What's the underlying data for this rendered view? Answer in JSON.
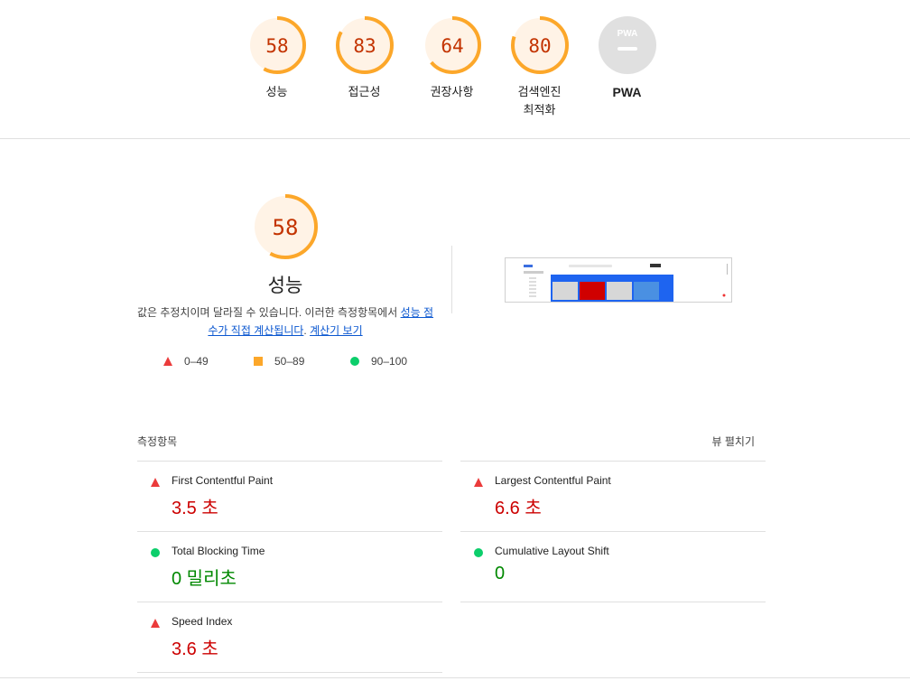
{
  "categories": [
    {
      "score": "58",
      "label": "성능",
      "progress": 0.58
    },
    {
      "score": "83",
      "label": "접근성",
      "progress": 0.83
    },
    {
      "score": "64",
      "label": "권장사항",
      "progress": 0.64
    },
    {
      "score": "80",
      "label": "검색엔진 최적화",
      "label_line1": "검색엔진",
      "label_line2": "최적화",
      "progress": 0.8
    },
    {
      "score": "",
      "label": "PWA",
      "badge_text": "PWA"
    }
  ],
  "performance": {
    "score": "58",
    "progress": 0.58,
    "title": "성능",
    "desc_text": "값은 추정치이며 달라질 수 있습니다. 이러한 측정항목에서 ",
    "desc_link1": "성능 점수가 직접 계산됩니다",
    "desc_sep": ". ",
    "desc_link2": "계산기 보기"
  },
  "legend": [
    {
      "range": "0–49",
      "shape": "triangle",
      "color": "#eb3b3b"
    },
    {
      "range": "50–89",
      "shape": "square",
      "color": "#fca72a"
    },
    {
      "range": "90–100",
      "shape": "circle",
      "color": "#0cce6b"
    }
  ],
  "metrics_header": {
    "title": "측정항목",
    "toggle": "뷰 펼치기"
  },
  "metrics": [
    {
      "name": "First Contentful Paint",
      "value": "3.5 초",
      "status": "fail"
    },
    {
      "name": "Largest Contentful Paint",
      "value": "6.6 초",
      "status": "fail"
    },
    {
      "name": "Total Blocking Time",
      "value": "0 밀리초",
      "status": "pass"
    },
    {
      "name": "Cumulative Layout Shift",
      "value": "0",
      "status": "pass"
    },
    {
      "name": "Speed Index",
      "value": "3.6 초",
      "status": "fail"
    }
  ],
  "colors": {
    "orange": "#fca72a",
    "orange_bg": "#fff3e6",
    "score_text": "#c33300",
    "fail": "#cc0000",
    "pass": "#008800",
    "pwa_bg": "#e0e0e0"
  }
}
